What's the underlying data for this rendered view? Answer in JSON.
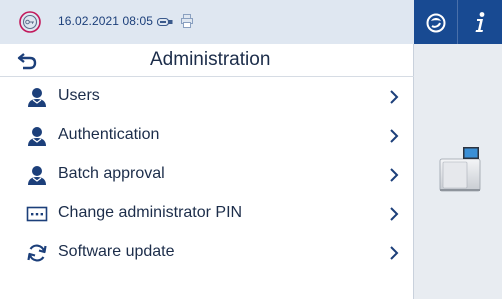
{
  "status": {
    "datetime": "16.02.2021 08:05",
    "icons": [
      "key-icon",
      "usb-icon",
      "printer-icon"
    ],
    "highlight_color": "#c2185b"
  },
  "header": {
    "title": "Administration",
    "back_icon": "back-arrow-icon"
  },
  "menu": {
    "items": [
      {
        "label": "Users",
        "icon": "user-icon"
      },
      {
        "label": "Authentication",
        "icon": "user-icon"
      },
      {
        "label": "Batch approval",
        "icon": "user-icon"
      },
      {
        "label": "Change administrator PIN",
        "icon": "pin-icon"
      },
      {
        "label": "Software update",
        "icon": "refresh-icon"
      }
    ]
  },
  "side": {
    "buttons": [
      "steam-mode-icon",
      "info-icon"
    ],
    "device_icon": "autoclave-icon"
  },
  "colors": {
    "accent": "#184a92",
    "text": "#1c2d4a",
    "statusbar_bg": "#dfe7f1"
  }
}
